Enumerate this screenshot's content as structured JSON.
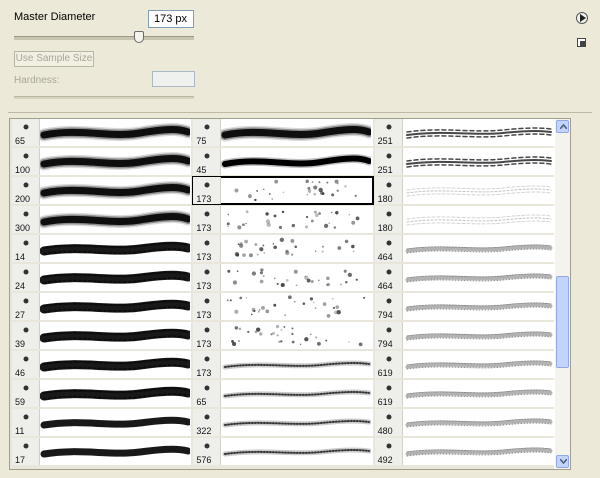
{
  "header": {
    "master_diameter_label": "Master Diameter",
    "master_diameter_value": "173 px",
    "slider_level": 0.69,
    "use_sample_size_label": "Use Sample Size",
    "hardness_label": "Hardness:",
    "hardness_value": ""
  },
  "icons": {
    "flyout": "play-circle-icon",
    "new_preset": "new-preset-icon"
  },
  "colors": {
    "panel_bg": "#ece9d8",
    "scroll_accent": "#c3d3fd",
    "selection": "#000000"
  },
  "brushes": {
    "columns": [
      [
        {
          "size": "65",
          "kind": "soft"
        },
        {
          "size": "100",
          "kind": "soft"
        },
        {
          "size": "200",
          "kind": "soft"
        },
        {
          "size": "300",
          "kind": "soft"
        },
        {
          "size": "14",
          "kind": "chalk"
        },
        {
          "size": "24",
          "kind": "chalk"
        },
        {
          "size": "27",
          "kind": "chalk"
        },
        {
          "size": "39",
          "kind": "chalk"
        },
        {
          "size": "46",
          "kind": "chalk"
        },
        {
          "size": "59",
          "kind": "chalk"
        },
        {
          "size": "11",
          "kind": "taper"
        },
        {
          "size": "17",
          "kind": "taper"
        }
      ],
      [
        {
          "size": "75",
          "kind": "soft"
        },
        {
          "size": "45",
          "kind": "hard"
        },
        {
          "size": "173",
          "kind": "star"
        },
        {
          "size": "173",
          "kind": "star"
        },
        {
          "size": "173",
          "kind": "star"
        },
        {
          "size": "173",
          "kind": "star"
        },
        {
          "size": "173",
          "kind": "star"
        },
        {
          "size": "173",
          "kind": "star"
        },
        {
          "size": "173",
          "kind": "dots"
        },
        {
          "size": "65",
          "kind": "dots"
        },
        {
          "size": "322",
          "kind": "dots"
        },
        {
          "size": "576",
          "kind": "dots"
        }
      ],
      [
        {
          "size": "251",
          "kind": "feather"
        },
        {
          "size": "251",
          "kind": "feather"
        },
        {
          "size": "180",
          "kind": "faint"
        },
        {
          "size": "180",
          "kind": "faint"
        },
        {
          "size": "464",
          "kind": "grass"
        },
        {
          "size": "464",
          "kind": "grass"
        },
        {
          "size": "794",
          "kind": "grass"
        },
        {
          "size": "794",
          "kind": "grass"
        },
        {
          "size": "619",
          "kind": "grass"
        },
        {
          "size": "619",
          "kind": "grass"
        },
        {
          "size": "480",
          "kind": "grass"
        },
        {
          "size": "492",
          "kind": "grass"
        }
      ]
    ],
    "selected": [
      1,
      2
    ]
  },
  "scrollbar": {
    "position": 0.62
  }
}
